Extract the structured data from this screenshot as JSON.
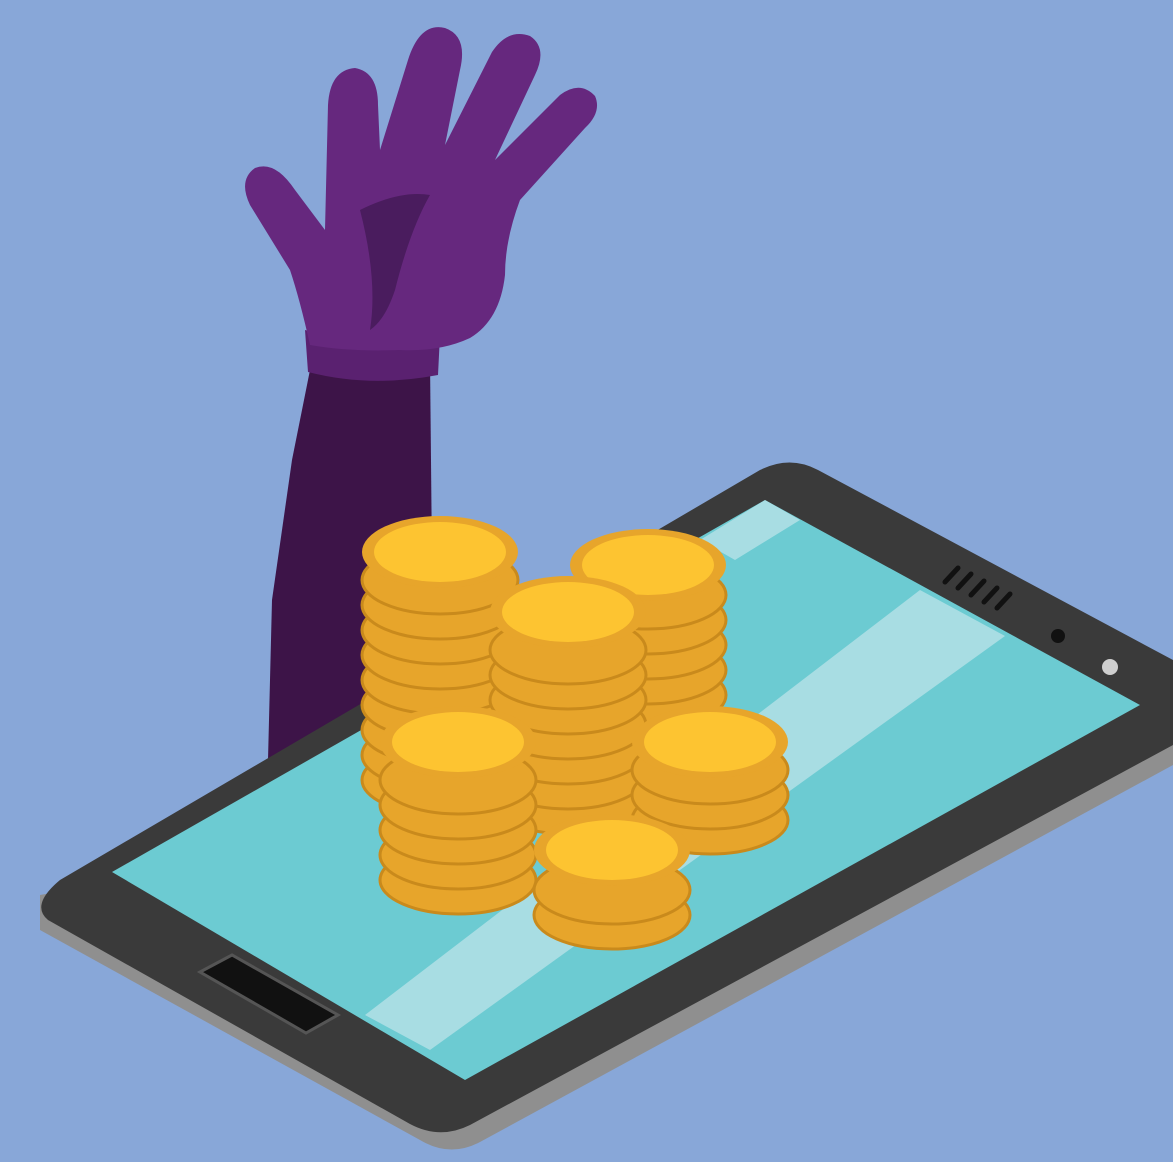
{
  "colors": {
    "background": "#88a7d8",
    "phone_body": "#3a3a3a",
    "phone_edge": "#8f8f8f",
    "screen": "#6ccbd2",
    "screen_glare": "#b3e1e6",
    "arm_sleeve": "#3d1448",
    "hand": "#66287e",
    "hand_shadow": "#4a1c5e",
    "coin_face": "#fdc431",
    "coin_edge": "#e7a52b",
    "coin_line": "#c98a1c"
  },
  "icons": [
    "hand-icon",
    "coin-stack-icon",
    "smartphone-icon"
  ]
}
